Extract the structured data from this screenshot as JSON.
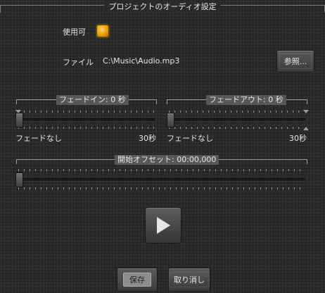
{
  "dialog": {
    "title": "プロジェクトのオーディオ設定"
  },
  "enabled": {
    "label": "使用可",
    "checked": true,
    "color": "#f2a90f"
  },
  "file": {
    "label": "ファイル",
    "path": "C:\\Music\\Audio.mp3",
    "browse_label": "参照..."
  },
  "fade_in": {
    "title": "フェードイン: 0 秒",
    "min_label": "フェードなし",
    "max_label": "30秒",
    "value": 0
  },
  "fade_out": {
    "title": "フェードアウト: 0 秒",
    "min_label": "フェードなし",
    "max_label": "30秒",
    "value": 0
  },
  "offset": {
    "title": "開始オフセット: 00:00,000",
    "value": 0
  },
  "playback": {
    "play_icon": "play-icon"
  },
  "actions": {
    "save_label": "保存",
    "cancel_label": "取り消し"
  }
}
